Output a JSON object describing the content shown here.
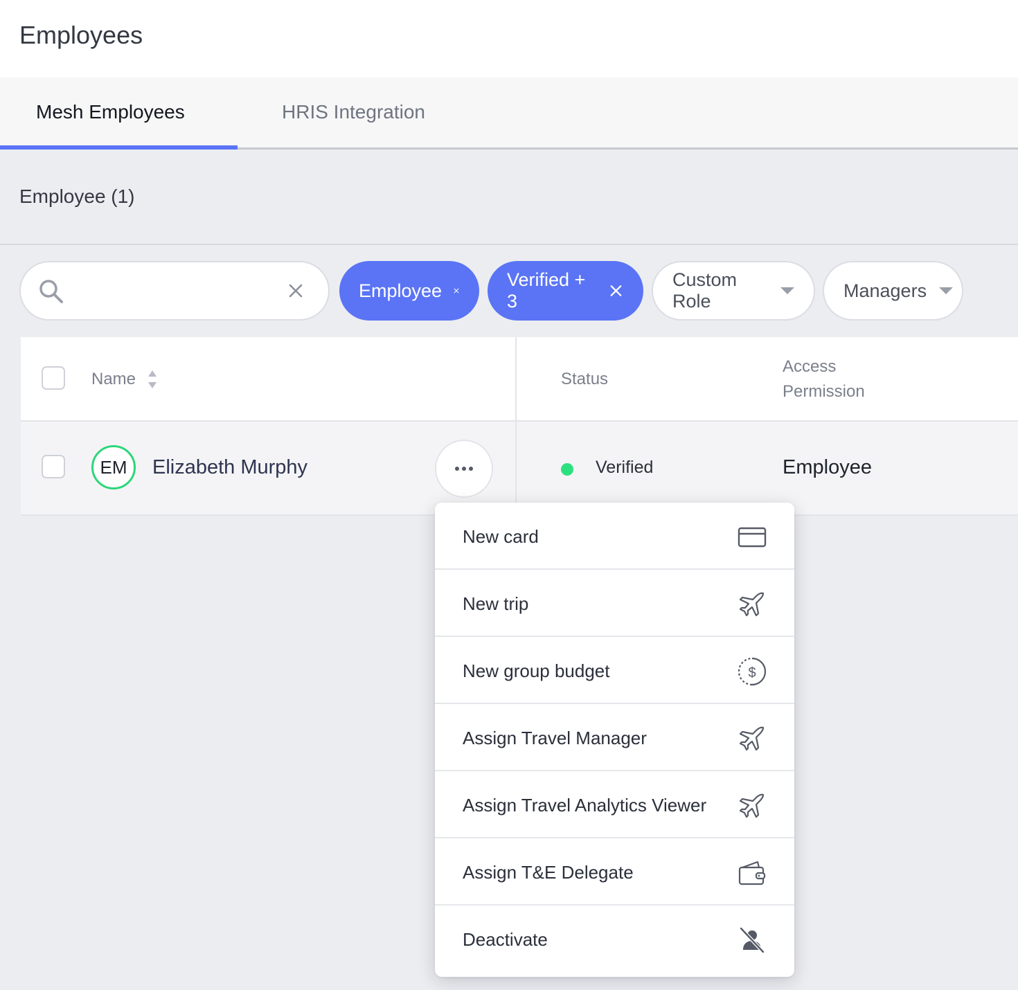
{
  "page": {
    "title": "Employees"
  },
  "tabs": [
    {
      "label": "Mesh Employees",
      "active": true
    },
    {
      "label": "HRIS Integration",
      "active": false
    }
  ],
  "section": {
    "title": "Employee (1)"
  },
  "search": {
    "value": "",
    "placeholder": "",
    "clear_icon": "close-icon"
  },
  "filters": [
    {
      "label": "Employee",
      "active": true,
      "icon": "close-icon"
    },
    {
      "label": "Verified + 3",
      "active": true,
      "icon": "close-icon"
    },
    {
      "label": "Custom Role",
      "active": false,
      "icon": "chevron-down-icon"
    },
    {
      "label": "Managers",
      "active": false,
      "icon": "chevron-down-icon"
    }
  ],
  "table": {
    "columns": [
      "Name",
      "Status",
      "Access",
      "Permission"
    ],
    "rows": [
      {
        "initials": "EM",
        "name": "Elizabeth Murphy",
        "status": "Verified",
        "permission": "Employee"
      }
    ]
  },
  "menu": {
    "items": [
      {
        "label": "New card",
        "icon": "credit-card-icon"
      },
      {
        "label": "New trip",
        "icon": "airplane-icon"
      },
      {
        "label": "New group budget",
        "icon": "dollar-circle-icon"
      },
      {
        "label": "Assign Travel Manager",
        "icon": "airplane-icon"
      },
      {
        "label": "Assign Travel Analytics Viewer",
        "icon": "airplane-icon"
      },
      {
        "label": "Assign T&E Delegate",
        "icon": "wallet-icon"
      },
      {
        "label": "Deactivate",
        "icon": "user-off-icon"
      }
    ]
  },
  "colors": {
    "accent": "#5A74F5",
    "verified": "#2DE07F",
    "background": "#ECEDF1"
  }
}
